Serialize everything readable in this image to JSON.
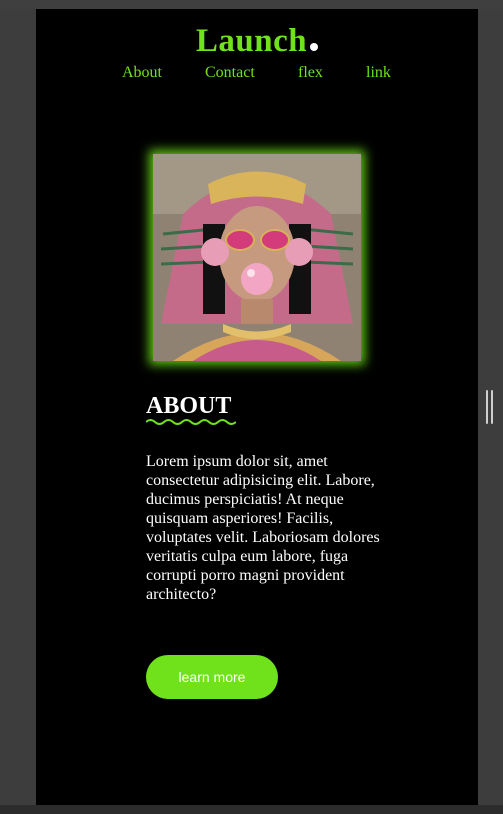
{
  "brand": {
    "logo": "Launch",
    "accent": "#6fe21c"
  },
  "nav": [
    {
      "label": "About"
    },
    {
      "label": "Contact"
    },
    {
      "label": "flex"
    },
    {
      "label": "link"
    }
  ],
  "about": {
    "heading": "ABOUT",
    "body": "Lorem ipsum dolor sit, amet consectetur adipisicing elit. Labore, ducimus perspiciatis! At neque quisquam asperiores! Facilis, voluptates velit. Laboriosam dolores veritatis culpa eum labore, fuga corrupti porro magni provident architecto?",
    "cta": "learn more"
  },
  "hero": {
    "icon": "hero-portrait-image"
  }
}
